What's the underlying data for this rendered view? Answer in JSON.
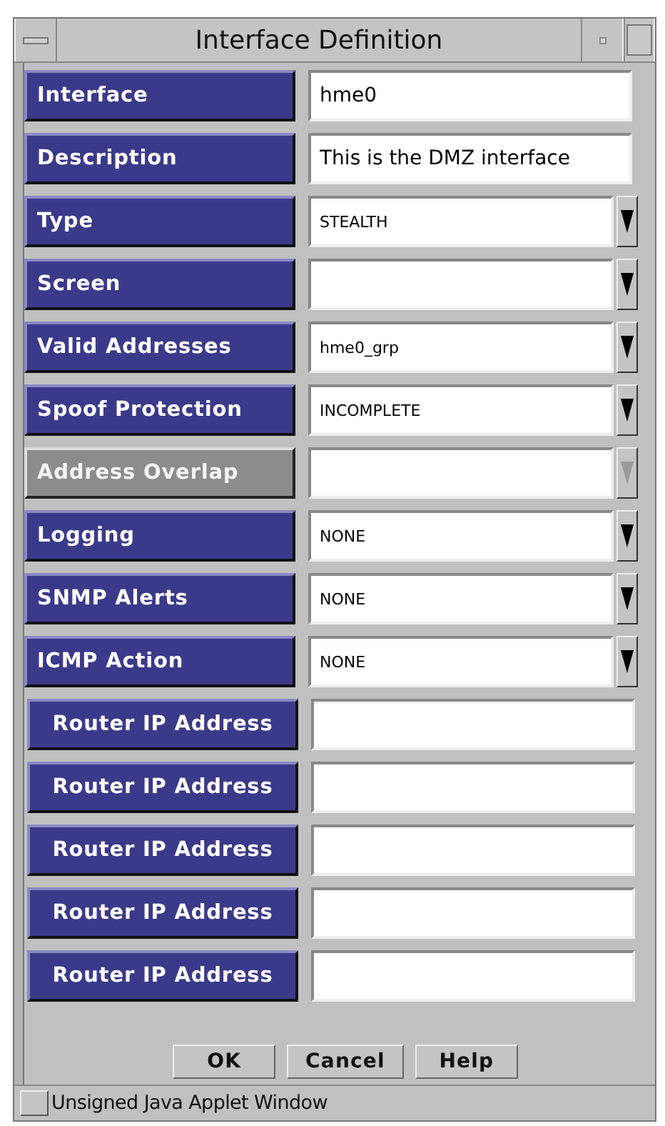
{
  "window": {
    "title": "Interface Definition"
  },
  "fields": [
    {
      "kind": "text",
      "label": "Interface",
      "value": "hme0",
      "disabled": false
    },
    {
      "kind": "text",
      "label": "Description",
      "value": "This is the DMZ interface",
      "disabled": false
    },
    {
      "kind": "combo",
      "label": "Type",
      "value": "STEALTH",
      "disabled": false
    },
    {
      "kind": "combo",
      "label": "Screen",
      "disabled": false
    },
    {
      "kind": "combo",
      "label": "Valid Addresses",
      "value": "hme0_grp",
      "disabled": false
    },
    {
      "kind": "combo",
      "label": "Spoof Protection",
      "value": "INCOMPLETE",
      "disabled": false
    },
    {
      "kind": "combo",
      "label": "Address Overlap",
      "disabled": true
    },
    {
      "kind": "combo",
      "label": "Logging",
      "value": "NONE",
      "disabled": false
    },
    {
      "kind": "combo",
      "label": "SNMP Alerts",
      "value": "NONE",
      "disabled": false
    },
    {
      "kind": "combo",
      "label": "ICMP Action",
      "value": "NONE",
      "disabled": false
    }
  ],
  "router_addresses": [
    {
      "label": "Router IP Address"
    },
    {
      "label": "Router IP Address"
    },
    {
      "label": "Router IP Address"
    },
    {
      "label": "Router IP Address"
    },
    {
      "label": "Router IP Address"
    }
  ],
  "buttons": [
    "OK",
    "Cancel",
    "Help"
  ],
  "status_bar": {
    "text": "Unsigned Java Applet Window"
  }
}
